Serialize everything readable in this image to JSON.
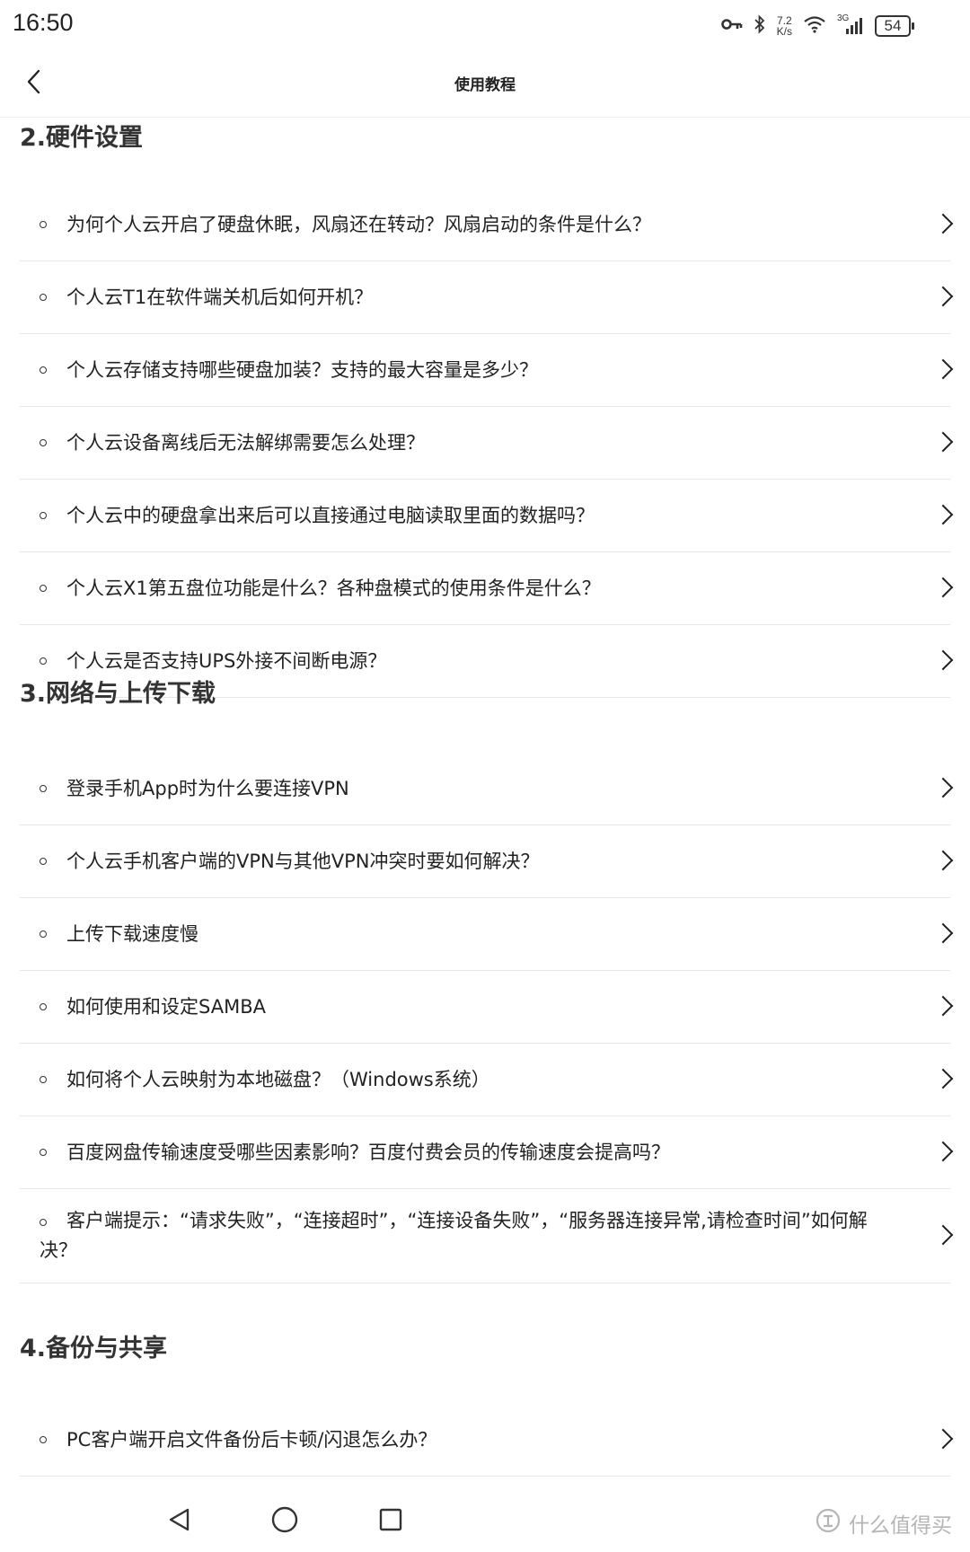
{
  "status_bar": {
    "time": "16:50",
    "net_speed_value": "7.2",
    "net_speed_unit": "K/s",
    "signal_label": "3G",
    "battery": "54",
    "icons": [
      "key-icon",
      "bluetooth-icon",
      "wifi-icon",
      "signal-icon",
      "battery-icon"
    ]
  },
  "header": {
    "title": "使用教程",
    "back_icon": "chevron-left-icon"
  },
  "sections": [
    {
      "title": "2.硬件设置",
      "items": [
        "为何个人云开启了硬盘休眠，风扇还在转动？风扇启动的条件是什么？",
        "个人云T1在软件端关机后如何开机？",
        "个人云存储支持哪些硬盘加装？支持的最大容量是多少？",
        "个人云设备离线后无法解绑需要怎么处理？",
        "个人云中的硬盘拿出来后可以直接通过电脑读取里面的数据吗？",
        "个人云X1第五盘位功能是什么？各种盘模式的使用条件是什么？",
        "个人云是否支持UPS外接不间断电源？"
      ]
    },
    {
      "title": "3.网络与上传下载",
      "items": [
        "登录手机App时为什么要连接VPN",
        "个人云手机客户端的VPN与其他VPN冲突时要如何解决？",
        "上传下载速度慢",
        "如何使用和设定SAMBA",
        "如何将个人云映射为本地磁盘？（Windows系统）",
        "百度网盘传输速度受哪些因素影响？百度付费会员的传输速度会提高吗？",
        "客户端提示：“请求失败”，“连接超时”，“连接设备失败”，“服务器连接异常,请检查时间”如何解决？"
      ]
    },
    {
      "title": "4.备份与共享",
      "items": [
        "PC客户端开启文件备份后卡顿/闪退怎么办？"
      ]
    }
  ],
  "nav_bar": {
    "icons": [
      "back-triangle-icon",
      "home-circle-icon",
      "recents-square-icon"
    ],
    "watermark": "什么值得买"
  },
  "colors": {
    "text": "#222222",
    "divider": "#e6e6e6",
    "background": "#ffffff",
    "watermark": "#b5b5b5"
  }
}
